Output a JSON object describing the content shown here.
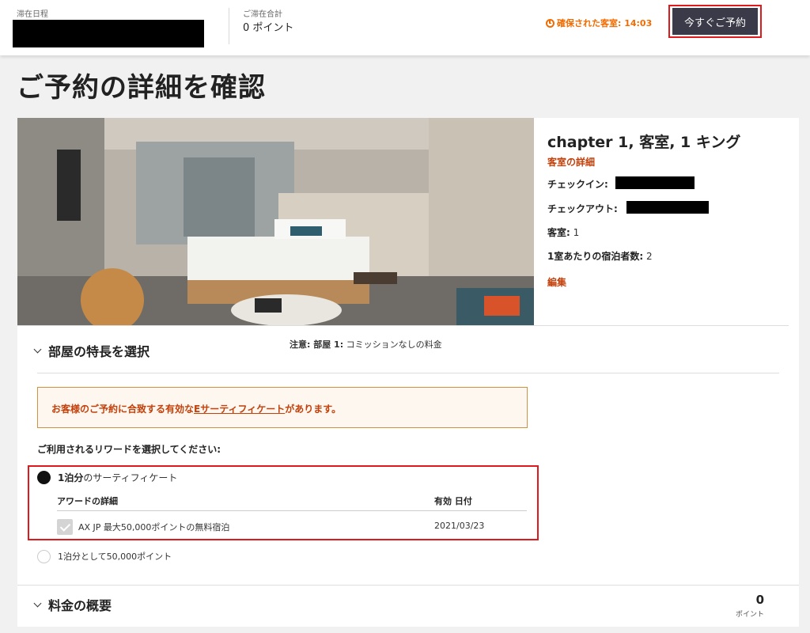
{
  "header": {
    "stay_dates_label": "滞在日程",
    "stay_total_label": "ご滞在合計",
    "stay_total_value": "0 ポイント",
    "room_held_text": "確保された客室: 14:03",
    "book_now_label": "今すぐご予約"
  },
  "page_title": "ご予約の詳細を確認",
  "room": {
    "title": "chapter 1, 客室, 1 キング",
    "details_link": "客室の詳細",
    "checkin_label": "チェックイン:",
    "checkout_label": "チェックアウト:",
    "rooms_label": "客室:",
    "rooms_value": "1",
    "guests_label": "1室あたりの宿泊者数:",
    "guests_value": "2",
    "edit_link": "編集"
  },
  "features": {
    "heading": "部屋の特長を選択",
    "note_label": "注意: 部屋 1:",
    "note_text": "コミッションなしの料金"
  },
  "certificate_notice": {
    "before": "お客様のご予約に合致する有効な",
    "link": "Eサーティフィケート",
    "after": "があります。"
  },
  "reward": {
    "prompt": "ご利用されるリワードを選択してください:",
    "option1_bold": "1泊分",
    "option1_rest": "のサーティフィケート",
    "col_award": "アワードの詳細",
    "col_expiry": "有効 日付",
    "award_detail": "AX JP 最大50,000ポイントの無料宿泊",
    "award_expiry": "2021/03/23",
    "option2": "1泊分として50,000ポイント"
  },
  "summary": {
    "heading": "料金の概要",
    "points_value": "0",
    "points_unit": "ポイント"
  },
  "colors": {
    "accent": "#c2410c",
    "timer": "#f26b00",
    "highlight": "#e0191c",
    "button": "#3a3a48"
  }
}
